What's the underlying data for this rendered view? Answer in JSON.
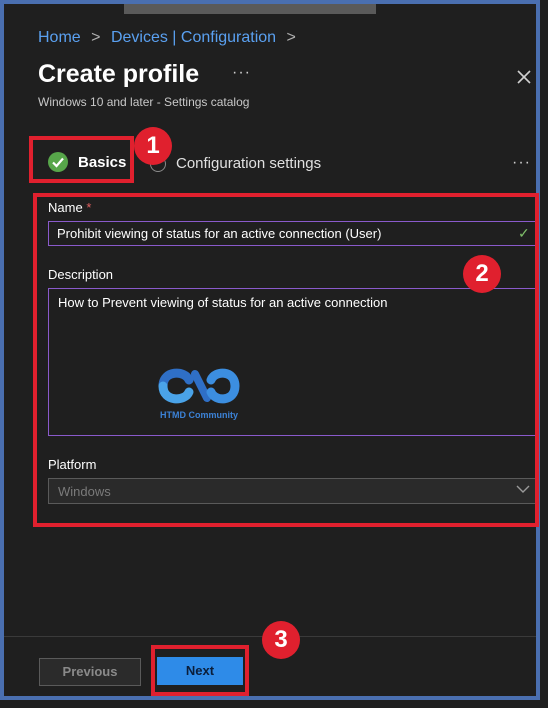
{
  "breadcrumb": {
    "home": "Home",
    "sep1": ">",
    "devices": "Devices | Configuration",
    "sep2": ">"
  },
  "header": {
    "title": "Create profile",
    "more": "···",
    "subtitle": "Windows 10 and later - Settings catalog"
  },
  "steps": [
    {
      "label": "Basics",
      "state": "complete"
    },
    {
      "label": "Configuration settings",
      "state": "pending"
    }
  ],
  "steps_more": "···",
  "form": {
    "name": {
      "label": "Name",
      "required_mark": "*",
      "value": "Prohibit viewing of status for an active connection (User)",
      "check": "✓"
    },
    "description": {
      "label": "Description",
      "value": "How to Prevent viewing of status for an active connection"
    },
    "platform": {
      "label": "Platform",
      "value": "Windows"
    }
  },
  "watermark": {
    "text": "HTMD Community"
  },
  "annotations": {
    "badge1": "1",
    "badge2": "2",
    "badge3": "3"
  },
  "footer": {
    "previous": "Previous",
    "next": "Next"
  },
  "colors": {
    "accent": "#2e8be8",
    "link": "#5aa0f0",
    "annotation": "#e0202e",
    "success": "#57a64a",
    "input_border": "#8a5acb"
  },
  "icons": {
    "close": "close-icon",
    "complete": "check-circle-icon",
    "chevron": "chevron-down-icon"
  }
}
